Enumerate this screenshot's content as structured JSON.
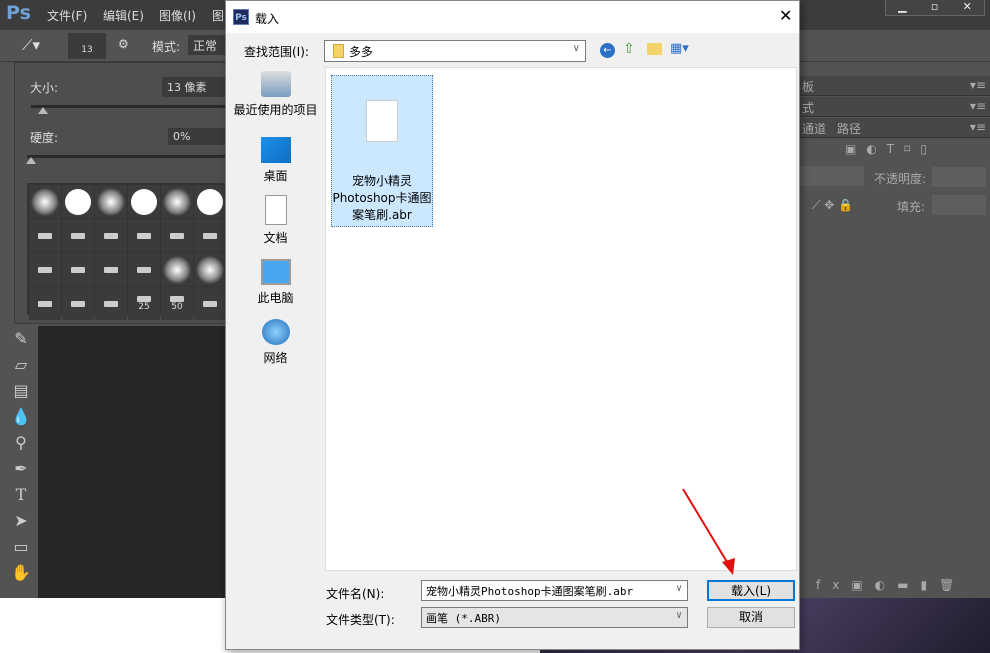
{
  "ps": {
    "logo": "Ps",
    "menu": [
      "文件(F)",
      "编辑(E)",
      "图像(I)",
      "图"
    ],
    "options": {
      "brush_size": "13",
      "mode_label": "模式:",
      "mode_value": "正常"
    },
    "brush_panel": {
      "size_label": "大小:",
      "size_value": "13 像素",
      "hardness_label": "硬度:",
      "hardness_value": "0%",
      "size_slider": 0.07,
      "hardness_slider": 0.0,
      "preset_labels": [
        "25",
        "50"
      ]
    },
    "right_panel": {
      "tabs": [
        "色板",
        "样式",
        "通道",
        "路径"
      ],
      "opacity_label": "不透明度:",
      "fill_label": "填充:"
    }
  },
  "dialog": {
    "title": "载入",
    "lookin_label": "查找范围(I):",
    "lookin_value": "多多",
    "places": [
      "最近使用的项目",
      "桌面",
      "文档",
      "此电脑",
      "网络"
    ],
    "file": {
      "name_lines": [
        "宠物小精灵",
        "Photoshop卡通图",
        "案笔刷.abr"
      ]
    },
    "filename_label": "文件名(N):",
    "filename_value": "宠物小精灵Photoshop卡通图案笔刷.abr",
    "filetype_label": "文件类型(T):",
    "filetype_value": "画笔 (*.ABR)",
    "load_button": "载入(L)",
    "cancel_button": "取消"
  }
}
